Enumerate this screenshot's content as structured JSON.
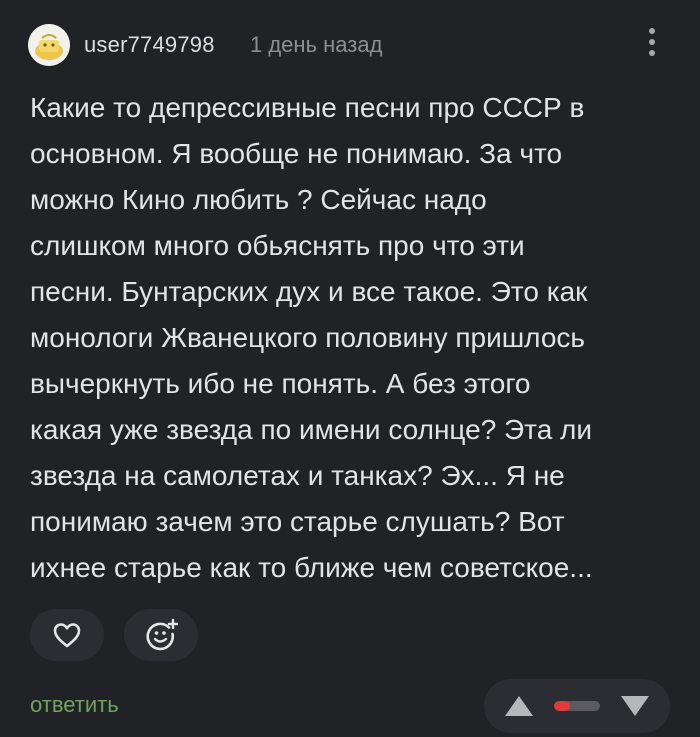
{
  "comment": {
    "author": "user7749798",
    "timestamp": "1 день назад",
    "body_lines": [
      "Какие то депрессивные песни про СССР в",
      "основном. Я вообще не понимаю. За что",
      "можно Кино любить ? Сейчас надо",
      "слишком много обьяснять про что эти",
      "песни. Бунтарских дух и все такое. Это как",
      "монологи Жванецкого половину пришлось",
      "вычеркнуть ибо не понять. А без этого",
      "какая уже звезда по имени солнце? Эта ли",
      "звезда на самолетах и танках? Эх... Я не",
      "понимаю зачем это старье слушать? Вот",
      "ихнее старье как то ближе чем советское..."
    ]
  },
  "actions": {
    "reply_label": "ответить"
  },
  "icons": {
    "more": "more-vertical-icon",
    "like": "heart-icon",
    "emoji": "emoji-add-icon",
    "upvote": "triangle-up-icon",
    "downvote": "triangle-down-icon"
  },
  "rating": {
    "negative_fraction": 0.35
  },
  "colors": {
    "background": "#212226",
    "text": "#e3e3e5",
    "muted": "#8e8f93",
    "reply": "#6fa35e",
    "rating_negative": "#e03a3a",
    "button_bg": "#2c2d32"
  }
}
